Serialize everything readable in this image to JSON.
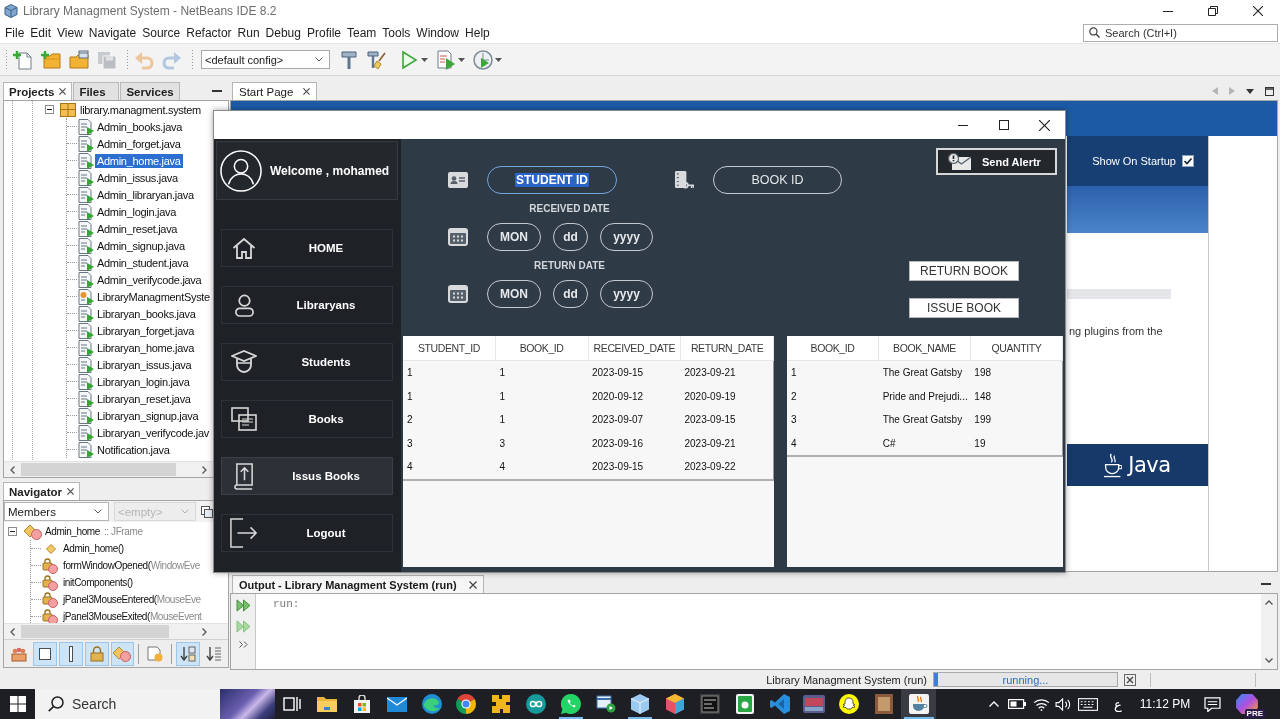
{
  "window": {
    "title": "Library Managment System - NetBeans IDE 8.2"
  },
  "menu_bar": {
    "items": [
      "File",
      "Edit",
      "View",
      "Navigate",
      "Source",
      "Refactor",
      "Run",
      "Debug",
      "Profile",
      "Team",
      "Tools",
      "Window",
      "Help"
    ],
    "search": {
      "placeholder": "Search (Ctrl+I)"
    }
  },
  "toolbar": {
    "groups": [
      [
        {
          "kind": "new_file",
          "disabled": false
        },
        {
          "kind": "new_project",
          "disabled": false
        },
        {
          "kind": "open_project",
          "disabled": false
        },
        {
          "kind": "save_all",
          "disabled": true
        }
      ],
      [
        {
          "kind": "undo",
          "disabled": true
        },
        {
          "kind": "redo",
          "disabled": true
        }
      ],
      [
        {
          "kind": "config",
          "value": "<default config>"
        },
        {
          "kind": "build",
          "disabled": false
        },
        {
          "kind": "clean_build",
          "disabled": false
        },
        {
          "kind": "run",
          "disabled": false,
          "dropdown": true
        },
        {
          "kind": "debug",
          "disabled": false,
          "dropdown": true
        },
        {
          "kind": "profile",
          "disabled": false,
          "dropdown": true
        }
      ]
    ]
  },
  "projects_panel": {
    "tabs": [
      {
        "label": "Projects",
        "selected": true
      },
      {
        "label": "Files",
        "selected": false
      },
      {
        "label": "Services",
        "selected": false
      }
    ],
    "tree": [
      {
        "label": "library.managment.system",
        "kind": "package",
        "expanded": true,
        "selected": false,
        "children": [
          {
            "label": "Admin_books.java",
            "kind": "file",
            "selected": false
          },
          {
            "label": "Admin_forget.java",
            "kind": "file",
            "selected": false
          },
          {
            "label": "Admin_home.java",
            "kind": "file",
            "selected": true
          },
          {
            "label": "Admin_issus.java",
            "kind": "file",
            "selected": false
          },
          {
            "label": "Admin_libraryan.java",
            "kind": "file",
            "selected": false
          },
          {
            "label": "Admin_login.java",
            "kind": "file",
            "selected": false
          },
          {
            "label": "Admin_reset.java",
            "kind": "file",
            "selected": false
          },
          {
            "label": "Admin_signup.java",
            "kind": "file",
            "selected": false
          },
          {
            "label": "Admin_student.java",
            "kind": "file",
            "selected": false
          },
          {
            "label": "Admin_verifycode.java",
            "kind": "file",
            "selected": false
          },
          {
            "label": "LibraryManagmentSyste",
            "kind": "main_class",
            "selected": false
          },
          {
            "label": "Libraryan_books.java",
            "kind": "file",
            "selected": false
          },
          {
            "label": "Libraryan_forget.java",
            "kind": "file",
            "selected": false
          },
          {
            "label": "Libraryan_home.java",
            "kind": "file",
            "selected": false
          },
          {
            "label": "Libraryan_issus.java",
            "kind": "file",
            "selected": false
          },
          {
            "label": "Libraryan_login.java",
            "kind": "file",
            "selected": false
          },
          {
            "label": "Libraryan_reset.java",
            "kind": "file",
            "selected": false
          },
          {
            "label": "Libraryan_signup.java",
            "kind": "file",
            "selected": false
          },
          {
            "label": "Libraryan_verifycode.jav",
            "kind": "file",
            "selected": false
          },
          {
            "label": "Notification.java",
            "kind": "file",
            "selected": false
          }
        ]
      }
    ]
  },
  "navigator_panel": {
    "tab": {
      "label": "Navigator"
    },
    "filter": {
      "value": "Members"
    },
    "scope": {
      "value": "<empty>",
      "disabled": true
    },
    "tree": [
      {
        "name": "Admin_home",
        "detail": ":: JFrame",
        "kind": "class",
        "expanded": true,
        "children": [
          {
            "name": "Admin_home()",
            "kind": "constructor"
          },
          {
            "name": "formWindowOpened(",
            "detail": "WindowEve",
            "kind": "private_method"
          },
          {
            "name": "initComponents()",
            "kind": "private_method"
          },
          {
            "name": "jPanel3MouseEntered(",
            "detail": "MouseEve",
            "kind": "private_method"
          },
          {
            "name": "jPanel3MouseExited(",
            "detail": "MouseEvent",
            "kind": "private_method"
          }
        ]
      }
    ],
    "filters": [
      [
        {
          "kind": "inherited",
          "on": false
        },
        {
          "kind": "fields",
          "on": true
        },
        {
          "kind": "static",
          "on": true
        },
        {
          "kind": "non_public",
          "on": true
        },
        {
          "kind": "inner_classes",
          "on": true
        }
      ],
      [
        {
          "kind": "javadoc",
          "on": false
        }
      ],
      [
        {
          "kind": "sort_name",
          "on": true
        },
        {
          "kind": "sort_source",
          "on": false
        }
      ]
    ]
  },
  "editor": {
    "tabs": [
      {
        "label": "Start Page",
        "selected": true
      }
    ]
  },
  "start_page": {
    "show_on_startup": {
      "label": "Show On Startup",
      "checked": true
    },
    "snippet": "ng plugins from the",
    "logo": "Java"
  },
  "app_window": {
    "sidebar": {
      "user": {
        "greeting": "Welcome , mohamed"
      },
      "items": [
        {
          "label": "HOME",
          "kind": "home",
          "selected": false
        },
        {
          "label": "Libraryans",
          "kind": "librarians",
          "selected": false
        },
        {
          "label": "Students",
          "kind": "students",
          "selected": false
        },
        {
          "label": "Books",
          "kind": "books",
          "selected": false
        },
        {
          "label": "Issus Books",
          "kind": "issue",
          "selected": true
        },
        {
          "label": "Logout",
          "kind": "logout",
          "selected": false
        }
      ]
    },
    "send_alert": {
      "label": "Send Alertr"
    },
    "student_id": {
      "value": "STUDENT ID",
      "focused": true
    },
    "book_id": {
      "value": "BOOK ID",
      "focused": false
    },
    "received_date": {
      "label": "RECEIVED DATE",
      "fields": [
        "MON",
        "dd",
        "yyyy"
      ]
    },
    "return_date": {
      "label": "RETURN DATE",
      "fields": [
        "MON",
        "dd",
        "yyyy"
      ]
    },
    "actions": [
      "RETURN BOOK",
      "ISSUE BOOK"
    ],
    "issues_table": {
      "columns": [
        "STUDENT_ID",
        "BOOK_ID",
        "RECEIVED_DATE",
        "RETURN_DATE"
      ],
      "rows": [
        [
          "1",
          "1",
          "2023-09-15",
          "2023-09-21"
        ],
        [
          "1",
          "1",
          "2020-09-12",
          "2020-09-19"
        ],
        [
          "2",
          "1",
          "2023-09-07",
          "2023-09-15"
        ],
        [
          "3",
          "3",
          "2023-09-16",
          "2023-09-21"
        ],
        [
          "4",
          "4",
          "2023-09-15",
          "2023-09-22"
        ]
      ]
    },
    "books_table": {
      "columns": [
        "BOOK_ID",
        "BOOK_NAME",
        "QUANTITY"
      ],
      "rows": [
        [
          "1",
          "The Great Gatsby",
          "198"
        ],
        [
          "2",
          "Pride and Prejudi...",
          "148"
        ],
        [
          "3",
          "The Great Gatsby",
          "199"
        ],
        [
          "4",
          "C#",
          "19"
        ]
      ]
    }
  },
  "output": {
    "title": "Output - Library Managment System (run)",
    "lines": [
      "run:"
    ]
  },
  "status_bar": {
    "task": "Library Managment System (run)",
    "progress": {
      "text": "running...",
      "level": 0.02
    }
  },
  "taskbar": {
    "search": {
      "placeholder": "Search"
    },
    "apps": [
      {
        "kind": "task_view",
        "running": false,
        "selected": false
      },
      {
        "kind": "folder",
        "running": false,
        "selected": false
      },
      {
        "kind": "bag",
        "running": false,
        "selected": false
      },
      {
        "kind": "envelope",
        "running": false,
        "selected": false
      },
      {
        "kind": "swirl",
        "running": false,
        "selected": false
      },
      {
        "kind": "tricolor",
        "running": false,
        "selected": false
      },
      {
        "kind": "puzzle",
        "running": false,
        "selected": false
      },
      {
        "kind": "infinity",
        "running": false,
        "selected": false
      },
      {
        "kind": "chat",
        "running": true,
        "selected": false
      },
      {
        "kind": "window_play",
        "running": false,
        "selected": false
      },
      {
        "kind": "cube",
        "running": true,
        "selected": false
      },
      {
        "kind": "gem",
        "running": false,
        "selected": false
      },
      {
        "kind": "terminal",
        "running": false,
        "selected": false
      },
      {
        "kind": "tile",
        "running": false,
        "selected": false
      },
      {
        "kind": "ribbon",
        "running": false,
        "selected": false
      },
      {
        "kind": "game",
        "running": false,
        "selected": false
      },
      {
        "kind": "ghost",
        "running": false,
        "selected": false
      },
      {
        "kind": "photo",
        "running": false,
        "selected": false
      },
      {
        "kind": "cup",
        "running": true,
        "selected": true
      }
    ],
    "tray": {
      "language": "ع",
      "time": "11:12 PM",
      "badge": "PRE"
    }
  }
}
